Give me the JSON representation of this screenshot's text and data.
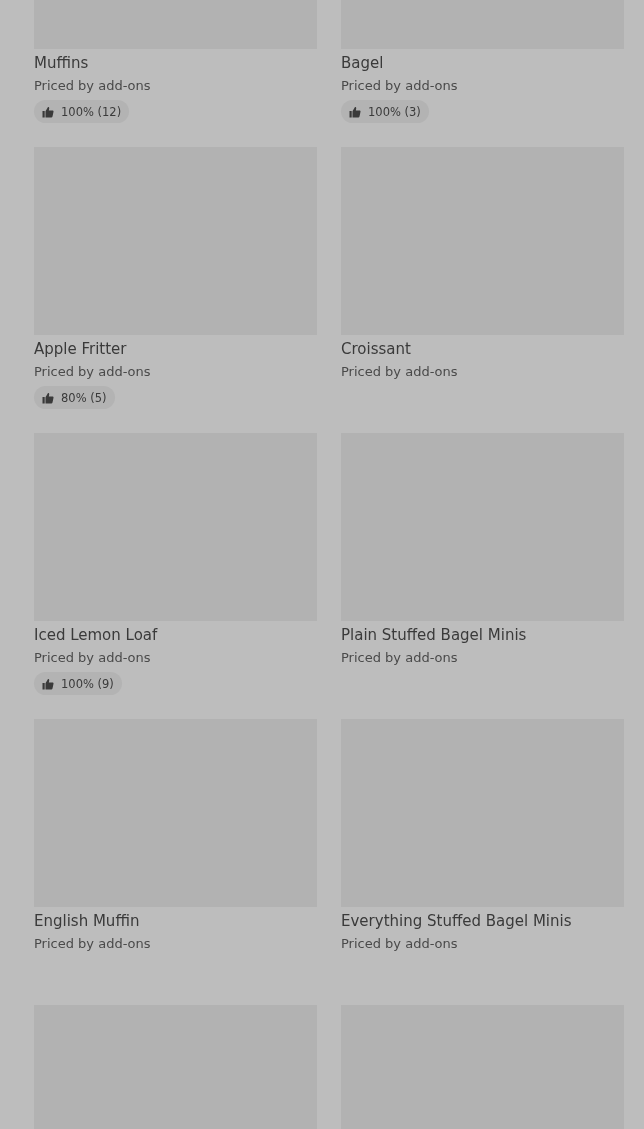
{
  "items": [
    {
      "kind": "product",
      "name": "Muffins",
      "subtitle": "Priced by add-ons",
      "rating": "100% (12)"
    },
    {
      "kind": "product",
      "name": "Bagel",
      "subtitle": "Priced by add-ons",
      "rating": "100% (3)"
    },
    {
      "kind": "product",
      "name": "Apple Fritter",
      "subtitle": "Priced by add-ons",
      "rating": "80% (5)"
    },
    {
      "kind": "product",
      "name": "Croissant",
      "subtitle": "Priced by add-ons"
    },
    {
      "kind": "product",
      "name": "Iced Lemon Loaf",
      "subtitle": "Priced by add-ons",
      "rating": "100% (9)"
    },
    {
      "kind": "product",
      "name": "Plain Stuffed Bagel Minis",
      "subtitle": "Priced by add-ons"
    },
    {
      "kind": "product",
      "name": "English Muffin",
      "subtitle": "Priced by add-ons"
    },
    {
      "kind": "product",
      "name": "Everything Stuffed Bagel Minis",
      "subtitle": "Priced by add-ons"
    },
    {
      "kind": "picture"
    },
    {
      "kind": "picture"
    }
  ]
}
